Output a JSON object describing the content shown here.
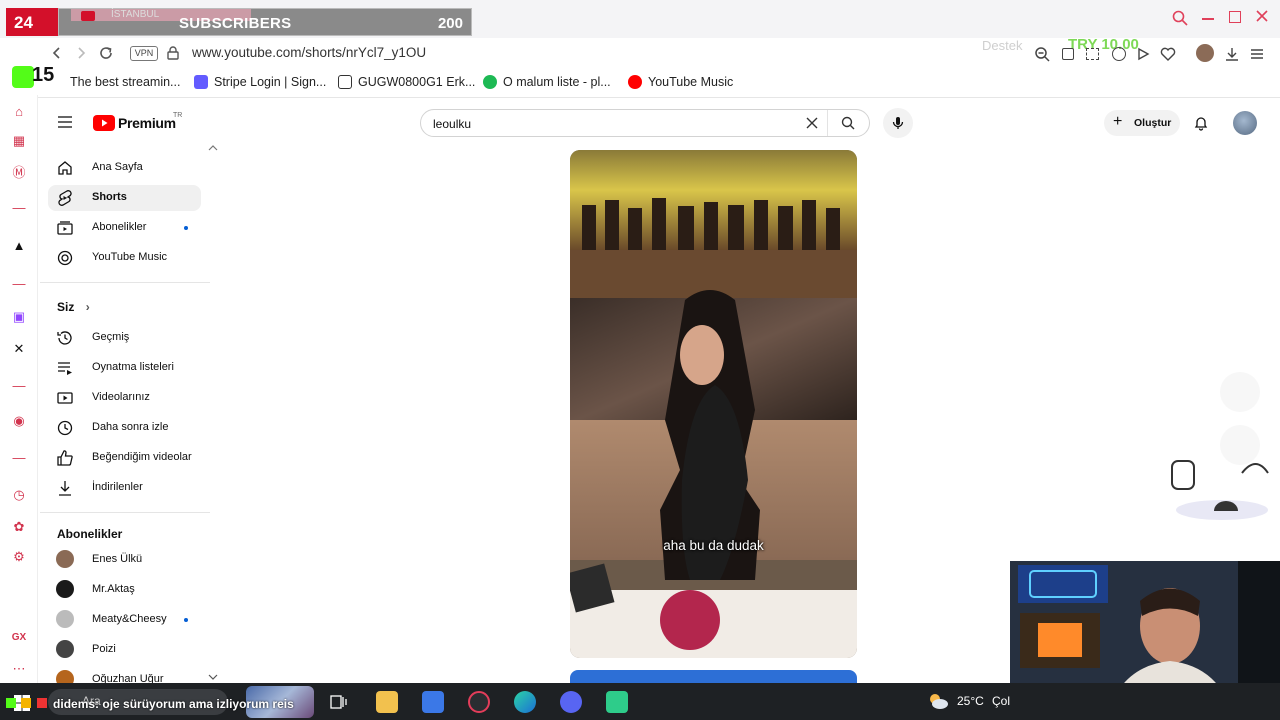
{
  "overlay": {
    "day_count": "24",
    "subscribers_label": "SUBSCRIBERS",
    "subscribers_count": "200",
    "tab_fragment": "İSTANBUL",
    "follow_count": "15",
    "donation": "TRY 10.00",
    "donor_fragment": "Destek",
    "chat_user": "didems",
    "chat_message": ": oje sürüyorum ama izliyorum reis"
  },
  "browser": {
    "vpn_label": "VPN",
    "url": "www.youtube.com/shorts/nrYcl7_y1OU",
    "bookmarks": [
      {
        "label": "The best streamin...",
        "color": "#7b7b7b"
      },
      {
        "label": "Stripe Login | Sign...",
        "color": "#635bff"
      },
      {
        "label": "GUGW0800G1 Erk...",
        "color": "#333333"
      },
      {
        "label": "O malum liste - pl...",
        "color": "#1db954"
      },
      {
        "label": "YouTube Music",
        "color": "#ff0000"
      }
    ]
  },
  "youtube": {
    "logo_text": "Premium",
    "logo_region": "TR",
    "search_value": "leoulku",
    "create_label": "Oluştur",
    "nav_main": [
      {
        "label": "Ana Sayfa",
        "icon": "home-icon"
      },
      {
        "label": "Shorts",
        "icon": "shorts-icon"
      },
      {
        "label": "Abonelikler",
        "icon": "subscriptions-icon"
      },
      {
        "label": "YouTube Music",
        "icon": "music-icon"
      }
    ],
    "you_section": "Siz",
    "nav_you": [
      {
        "label": "Geçmiş",
        "icon": "history-icon"
      },
      {
        "label": "Oynatma listeleri",
        "icon": "playlists-icon"
      },
      {
        "label": "Videolarınız",
        "icon": "your-videos-icon"
      },
      {
        "label": "Daha sonra izle",
        "icon": "watch-later-icon"
      },
      {
        "label": "Beğendiğim videolar",
        "icon": "liked-icon"
      },
      {
        "label": "İndirilenler",
        "icon": "downloads-icon"
      }
    ],
    "subs_section": "Abonelikler",
    "subscriptions": [
      {
        "label": "Enes Ülkü",
        "color": "#8a6a55"
      },
      {
        "label": "Mr.Aktaş",
        "color": "#1a1a1a"
      },
      {
        "label": "Meaty&Cheesy",
        "color": "#bbbbbb"
      },
      {
        "label": "Poizi",
        "color": "#444444"
      },
      {
        "label": "Oğuzhan Uğur",
        "color": "#b5651d"
      }
    ],
    "short_caption": "aha bu da dudak"
  },
  "taskbar": {
    "search_placeholder": "Ara",
    "weather": "25°C",
    "weather_desc": "Çol"
  }
}
